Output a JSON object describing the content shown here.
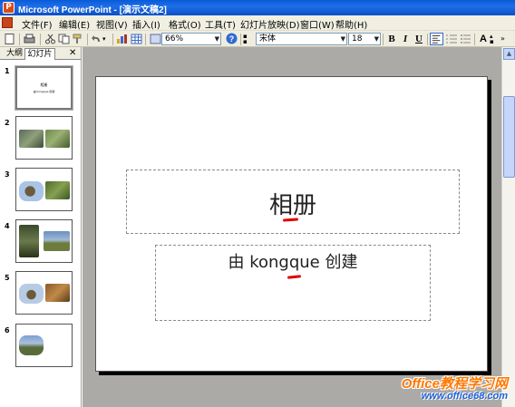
{
  "window": {
    "title": "Microsoft PowerPoint - [演示文稿2]"
  },
  "menu": [
    "文件(F)",
    "编辑(E)",
    "视图(V)",
    "插入(I)",
    "格式(O)",
    "工具(T)",
    "幻灯片放映(D)",
    "窗口(W)",
    "帮助(H)"
  ],
  "toolbar": {
    "zoom": "66%",
    "font": "宋体",
    "font_size": "18",
    "bold": "B",
    "italic": "I",
    "underline": "U",
    "grow_font": "A"
  },
  "pane": {
    "tabs": {
      "outline": "大纲",
      "slides": "幻灯片",
      "close": "✕"
    },
    "slides": [
      {
        "num": "1",
        "title": "相册",
        "subtitle": "由 kongque 创建"
      },
      {
        "num": "2"
      },
      {
        "num": "3"
      },
      {
        "num": "4"
      },
      {
        "num": "5"
      },
      {
        "num": "6"
      }
    ]
  },
  "slide": {
    "title": "相册",
    "subtitle": "由 kongque 创建"
  },
  "watermark": {
    "main": "Office教程学习网",
    "url": "www.office68.com"
  },
  "colors": {
    "titlebar": "#0a5bd8",
    "workspace": "#acaaa6",
    "red_mark": "#e00000",
    "watermark_orange": "#ff7800",
    "watermark_blue": "#1b5fd6"
  }
}
